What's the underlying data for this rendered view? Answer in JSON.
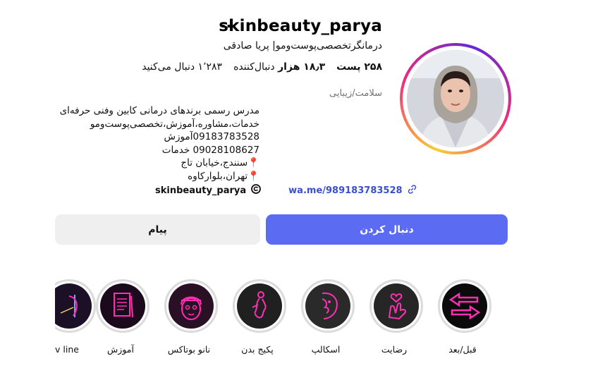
{
  "profile": {
    "username": "skinbeauty_parya",
    "more_icon": "more-horizontal-icon",
    "full_name": "درمانگرتخصصی‌پوست‌ومو| پریا صادقی",
    "stats": {
      "posts": "۲۵۸ پست",
      "followers_num": "۱۸٫۳ هزار",
      "followers_label": "دنبال‌کننده",
      "following": "۱٬۲۸۳ دنبال می‌کنید"
    },
    "category": "سلامت/زیبایی",
    "bio_lines": [
      "مدرس رسمی برندهای درمانی کابین  وفنی حرفه‌ای",
      "خدمات،مشاوره،آموزش،تخصصی‌پوست‌ومو",
      "09183783528آموزش",
      "09028108627 خدمات",
      "📍سنندج،خیابان تاج",
      "📍تهران،بلوارکاوه"
    ],
    "threads_handle": "skinbeauty_parya",
    "link": "wa.me/989183783528"
  },
  "actions": {
    "message": "پیام",
    "follow": "دنبال کردن"
  },
  "highlights": [
    {
      "label": "قبل/بعد",
      "icon": "arrows-icon"
    },
    {
      "label": "رضایت",
      "icon": "heart-hand-icon"
    },
    {
      "label": "اسکالپ",
      "icon": "face-icon"
    },
    {
      "label": "پکیج بدن",
      "icon": "body-icon"
    },
    {
      "label": "نانو بوتاکس",
      "icon": "face-mask-icon"
    },
    {
      "label": "آموزش",
      "icon": "document-icon"
    },
    {
      "label": "v line",
      "icon": "face-scan-icon"
    }
  ],
  "colors": {
    "follow_button": "#5b6cf2",
    "message_button": "#efeff0",
    "link": "#3a4fd0",
    "neon_pink": "#ff2fb3"
  }
}
